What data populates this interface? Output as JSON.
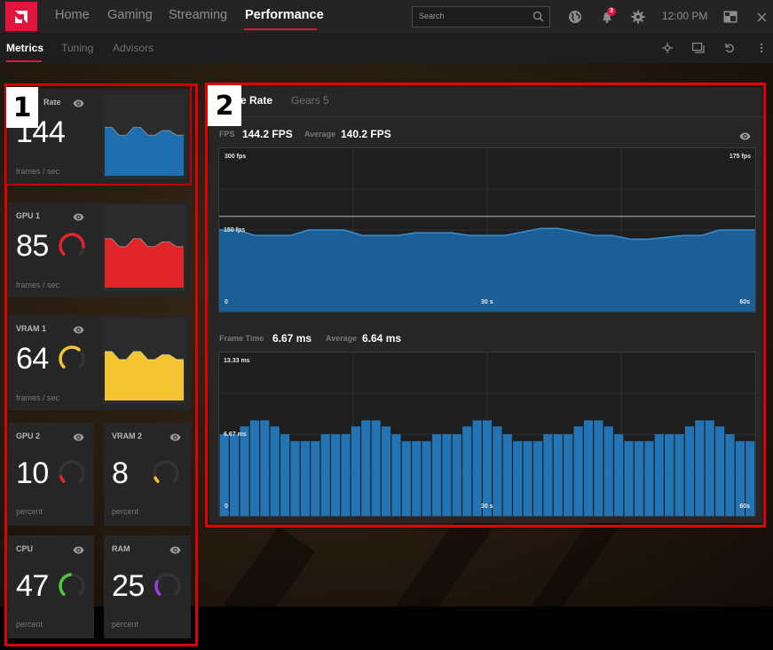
{
  "topnav": {
    "tabs": [
      {
        "label": "Home",
        "active": false
      },
      {
        "label": "Gaming",
        "active": false
      },
      {
        "label": "Streaming",
        "active": false
      },
      {
        "label": "Performance",
        "active": true
      }
    ],
    "search_placeholder": "Search",
    "notification_count": "3",
    "clock": "12:00 PM",
    "accent_color": "#e0143c"
  },
  "subnav": {
    "tabs": [
      {
        "label": "Metrics",
        "active": true
      },
      {
        "label": "Tuning",
        "active": false
      },
      {
        "label": "Advisors",
        "active": false
      }
    ]
  },
  "annotations": {
    "left_box_label": "1",
    "right_box_label": "2"
  },
  "metrics": [
    {
      "title": "Frame Rate",
      "title_visible": "Rate",
      "value": "144",
      "unit": "frames / sec",
      "color": "#1f6fb0",
      "selected": true
    },
    {
      "title": "GPU 1",
      "value": "85",
      "unit": "frames / sec",
      "color": "#e0262b",
      "gauge": 0.85
    },
    {
      "title": "VRAM 1",
      "value": "64",
      "unit": "frames / sec",
      "color": "#f2c531",
      "gauge": 0.64
    },
    {
      "title": "GPU 2",
      "value": "10",
      "unit": "percent",
      "color": "#e0262b",
      "gauge": 0.1
    },
    {
      "title": "VRAM 2",
      "value": "8",
      "unit": "percent",
      "color": "#f2c531",
      "gauge": 0.08
    },
    {
      "title": "CPU",
      "value": "47",
      "unit": "percent",
      "color": "#4cc93a",
      "gauge": 0.47
    },
    {
      "title": "RAM",
      "value": "25",
      "unit": "percent",
      "color": "#9b3fe0",
      "gauge": 0.25
    }
  ],
  "panel": {
    "tabs": [
      {
        "label": "Frame Rate",
        "visible_label": "e Rate",
        "active": true
      },
      {
        "label": "Gears 5",
        "active": false
      }
    ],
    "fps_label": "FPS",
    "fps_value": "144.2 FPS",
    "fps_avg_label": "Average",
    "fps_avg_value": "140.2 FPS",
    "ft_label": "Frame Time",
    "ft_value": "6.67 ms",
    "ft_avg_label": "Average",
    "ft_avg_value": "6.64 ms"
  },
  "chart_data": [
    {
      "type": "area",
      "title": "Frame Rate",
      "ylabel_top": "300 fps",
      "ylabel_mid": "150 fps",
      "ylabel_right": "175 fps",
      "xlabels": [
        "0",
        "30 s",
        "60s"
      ],
      "xlim": [
        0,
        60
      ],
      "ylim": [
        0,
        300
      ],
      "reference_line": 175,
      "grid": true,
      "color": "#1c5f96",
      "line_color": "#3a8fd0",
      "x": [
        0,
        2,
        4,
        8,
        10,
        14,
        16,
        20,
        22,
        26,
        28,
        30,
        32,
        36,
        38,
        42,
        44,
        46,
        48,
        52,
        54,
        56,
        60
      ],
      "y": [
        150,
        150,
        140,
        140,
        150,
        150,
        140,
        140,
        145,
        145,
        140,
        140,
        140,
        153,
        153,
        140,
        140,
        133,
        133,
        140,
        140,
        150,
        150
      ]
    },
    {
      "type": "bar",
      "title": "Frame Time",
      "ylabel_top": "13.33 ms",
      "ylabel_mid": "6.67 ms",
      "xlabels": [
        "0",
        "30 s",
        "60s"
      ],
      "ylim": [
        0,
        13.33
      ],
      "grid": true,
      "color": "#2374b5",
      "values": [
        6.67,
        6.67,
        7.3,
        7.8,
        7.8,
        7.3,
        6.67,
        6.1,
        6.1,
        6.1,
        6.67,
        6.67,
        6.67,
        7.3,
        7.8,
        7.8,
        7.3,
        6.67,
        6.1,
        6.1,
        6.1,
        6.67,
        6.67,
        6.67,
        7.3,
        7.8,
        7.8,
        7.3,
        6.67,
        6.1,
        6.1,
        6.1,
        6.67,
        6.67,
        6.67,
        7.3,
        7.8,
        7.8,
        7.3,
        6.67,
        6.1,
        6.1,
        6.1,
        6.67,
        6.67,
        6.67,
        7.3,
        7.8,
        7.8,
        7.3,
        6.67,
        6.1,
        6.1
      ]
    }
  ]
}
